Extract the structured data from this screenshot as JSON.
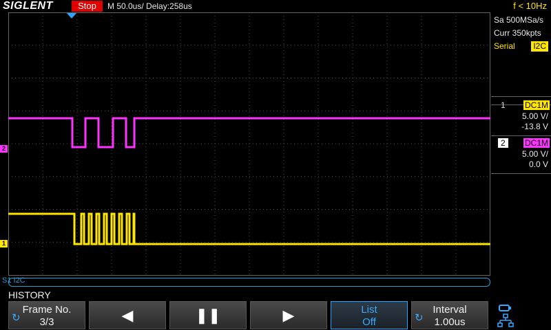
{
  "topbar": {
    "logo": "SIGLENT",
    "run_status": "Stop",
    "timebase": "M 50.0us/  Delay:258us",
    "freq": "f < 10Hz"
  },
  "panel": {
    "sample_rate": "Sa 500MSa/s",
    "curr_points": "Curr 350kpts",
    "serial_label": "Serial",
    "serial_protocol": "I2C",
    "channels": [
      {
        "num": "1",
        "coupling": "DC1M",
        "scale": "5.00 V/",
        "offset": "-13.8 V",
        "color": "#ffe600"
      },
      {
        "num": "2",
        "coupling": "DC1M",
        "scale": "5.00 V/",
        "offset": "0.0 V",
        "color": "#ff33ff"
      }
    ]
  },
  "markers": {
    "ch1": "1",
    "ch2": "2",
    "serial_label": "S1 I2C"
  },
  "history": {
    "title": "HISTORY",
    "frame_label": "Frame No.",
    "frame_value": "3/3",
    "list_label": "List",
    "list_value": "Off",
    "interval_label": "Interval",
    "interval_value": "1.00us"
  },
  "icons": {
    "prev": "prev-icon",
    "pause": "pause-icon",
    "next": "next-icon",
    "knob": "knob-icon"
  },
  "colors": {
    "ch1": "#ffe600",
    "ch2": "#ff33ff",
    "serial": "#2a9fd6",
    "stop": "#e00000"
  }
}
